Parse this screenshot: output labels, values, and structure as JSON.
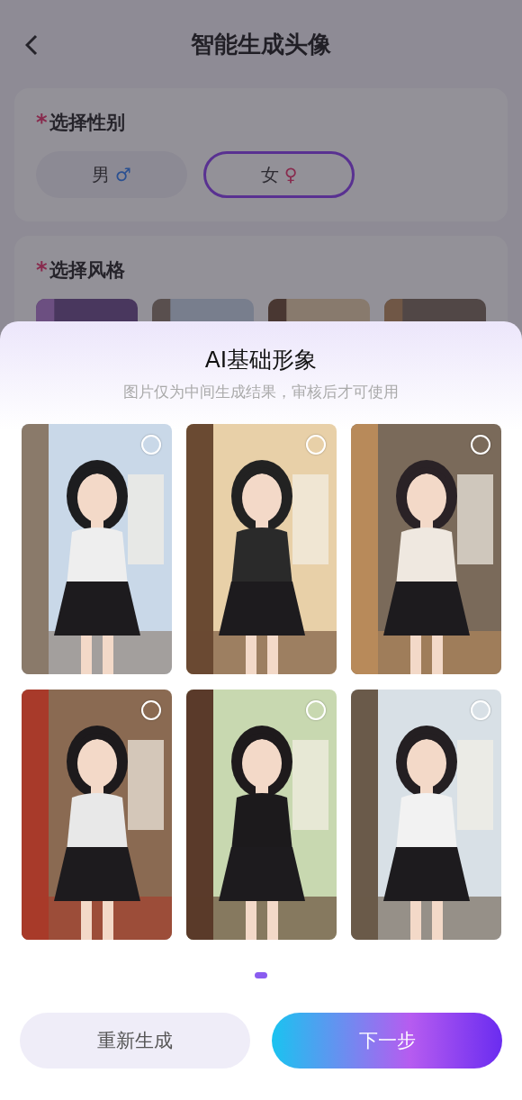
{
  "header": {
    "title": "智能生成头像"
  },
  "gender": {
    "required_mark": "*",
    "label": "选择性别",
    "options": [
      {
        "label": "男",
        "symbol": "♂",
        "selected": false
      },
      {
        "label": "女",
        "symbol": "♀",
        "selected": true
      }
    ]
  },
  "style": {
    "required_mark": "*",
    "label": "选择风格"
  },
  "sheet": {
    "title": "AI基础形象",
    "subtitle": "图片仅为中间生成结果，审核后才可使用",
    "pages": [
      {
        "selected": true
      }
    ]
  },
  "buttons": [
    {
      "label": "重新生成",
      "kind": "secondary"
    },
    {
      "label": "下一步",
      "kind": "primary"
    }
  ]
}
